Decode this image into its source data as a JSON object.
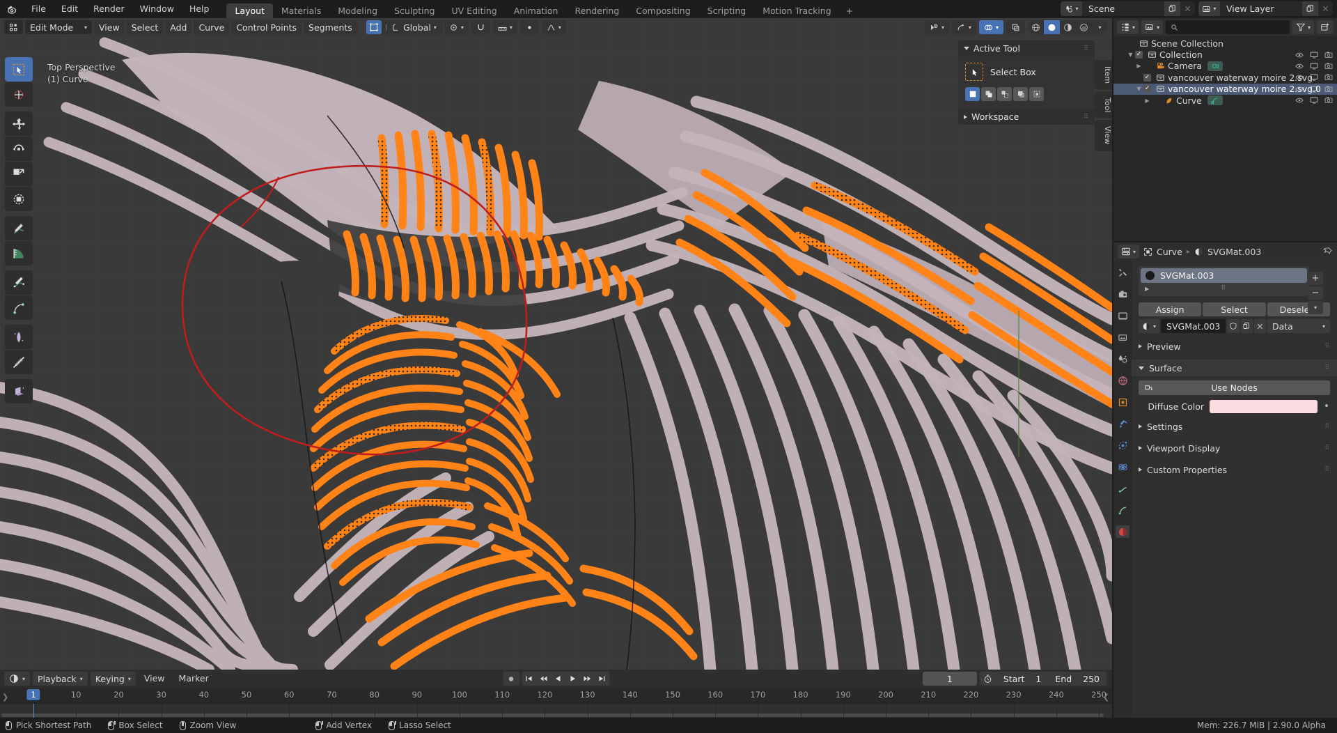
{
  "app": {
    "version_status": "Mem: 226.7 MiB | 2.90.0 Alpha"
  },
  "topbar": {
    "logo": "blender-logo",
    "menus": [
      "File",
      "Edit",
      "Render",
      "Window",
      "Help"
    ],
    "workspace_tabs": [
      {
        "label": "Layout",
        "active": true
      },
      {
        "label": "Materials",
        "active": false
      },
      {
        "label": "Modeling",
        "active": false
      },
      {
        "label": "Sculpting",
        "active": false
      },
      {
        "label": "UV Editing",
        "active": false
      },
      {
        "label": "Animation",
        "active": false
      },
      {
        "label": "Rendering",
        "active": false
      },
      {
        "label": "Compositing",
        "active": false
      },
      {
        "label": "Scripting",
        "active": false
      },
      {
        "label": "Motion Tracking",
        "active": false
      }
    ],
    "add_workspace": "+",
    "scene": {
      "icon": "scene-icon",
      "name": "Scene",
      "new_icon": "duplicate-icon",
      "unlink_icon": "x-icon"
    },
    "view_layer": {
      "icon": "viewlayer-icon",
      "name": "View Layer",
      "new_icon": "duplicate-icon",
      "unlink_icon": "x-icon"
    }
  },
  "viewport": {
    "header": {
      "mode": "Edit Mode",
      "menus": [
        "View",
        "Select",
        "Add",
        "Curve",
        "Control Points",
        "Segments"
      ],
      "transform_orientation": "Global",
      "pivot_icon": "pivot-icon",
      "snap_icon": "magnet-icon",
      "snap_to_icon": "snap-increment-icon",
      "proportional_icon": "proportional-editing-icon",
      "falloff_icon": "falloff-curve-icon",
      "visibility_icon": "object-visibility-icon",
      "gizmo_icon": "gizmo-icon",
      "overlays_icon": "overlays-icon",
      "xray_icon": "xray-icon",
      "shading_modes": [
        "wireframe",
        "solid",
        "material-preview",
        "rendered"
      ],
      "shading_active": "solid"
    },
    "overlay_text_line1": "Top Perspective",
    "overlay_text_line2": "(1) Curve",
    "toolbar_tools": [
      {
        "name": "tweak-tool",
        "active": true
      },
      {
        "name": "cursor-tool",
        "active": false
      },
      {
        "name": "move-tool",
        "active": false
      },
      {
        "name": "rotate-tool",
        "active": false
      },
      {
        "name": "scale-tool",
        "active": false
      },
      {
        "name": "transform-tool",
        "active": false
      },
      {
        "name": "annotate-tool",
        "active": false
      },
      {
        "name": "measure-tool",
        "active": false
      },
      {
        "name": "draw-curve-tool",
        "active": false
      },
      {
        "name": "extrude-curve-tool",
        "active": false
      },
      {
        "name": "radius-tool",
        "active": false
      },
      {
        "name": "tilt-tool",
        "active": false
      },
      {
        "name": "shear-tool",
        "active": false
      }
    ],
    "npanel": {
      "active_tool_label": "Active Tool",
      "tool_name": "Select Box",
      "tool_icon": "select-box-icon",
      "select_modes": [
        {
          "name": "set-mode",
          "active": true
        },
        {
          "name": "extend-mode",
          "active": false
        },
        {
          "name": "subtract-mode",
          "active": false
        },
        {
          "name": "invert-mode",
          "active": false
        },
        {
          "name": "intersect-mode",
          "active": false
        }
      ],
      "workspace_label": "Workspace",
      "vertical_tabs": [
        "Item",
        "Tool",
        "View"
      ]
    },
    "colors": {
      "background": "#3a3a3a",
      "curve_fill": "#c4b4bb",
      "selected_orange": "#ff8317",
      "control_point_dark": "#1b1b1b",
      "active_curve_red": "#c01d1d",
      "grid": "#464646"
    }
  },
  "outliner": {
    "display_mode_icon": "outliner-view-layer-icon",
    "filter_scene_icon": "viewlayer-icon",
    "search_placeholder": "",
    "search_icon": "search-icon",
    "filter_icon": "filter-icon",
    "new_collection_icon": "new-collection-icon",
    "restrict_columns": [
      "hide-in-viewport-icon",
      "disable-in-viewports-icon",
      "disable-in-renders-icon"
    ],
    "rows": [
      {
        "label": "Scene Collection",
        "icon": "collection-icon",
        "indent": 0,
        "disclosure": "",
        "checkbox": false,
        "selected": false,
        "restrict": false,
        "chip": ""
      },
      {
        "label": "Collection",
        "icon": "collection-icon",
        "indent": 1,
        "disclosure": "open",
        "checkbox": true,
        "selected": false,
        "restrict": true,
        "chip": ""
      },
      {
        "label": "Camera",
        "icon": "camera-object-icon",
        "indent": 2,
        "disclosure": "closed",
        "checkbox": false,
        "selected": false,
        "restrict": true,
        "chip": "camera-data-icon"
      },
      {
        "label": "vancouver waterway moire 2.svg",
        "icon": "collection-icon",
        "indent": 2,
        "disclosure": "",
        "checkbox": true,
        "selected": false,
        "restrict": true,
        "chip": ""
      },
      {
        "label": "vancouver waterway moire 2.svg.0",
        "icon": "collection-icon",
        "indent": 2,
        "disclosure": "open",
        "checkbox": true,
        "selected": true,
        "restrict": true,
        "chip": ""
      },
      {
        "label": "Curve",
        "icon": "curve-object-icon",
        "indent": 3,
        "disclosure": "closed",
        "checkbox": false,
        "selected": false,
        "restrict": true,
        "chip": "curve-data-icon"
      }
    ]
  },
  "properties": {
    "editor_icon": "properties-editor-icon",
    "breadcrumb": [
      {
        "label": "Curve",
        "icon": "object-data-icon"
      },
      {
        "label": "SVGMat.003",
        "icon": "material-icon"
      }
    ],
    "pin_icon": "pin-icon",
    "tabs": [
      {
        "name": "tool-tab",
        "active": false
      },
      {
        "name": "render-tab",
        "active": false
      },
      {
        "name": "output-tab",
        "active": false
      },
      {
        "name": "view-layer-tab",
        "active": false
      },
      {
        "name": "scene-tab",
        "active": false
      },
      {
        "name": "world-tab",
        "active": false
      },
      {
        "name": "object-tab",
        "active": false
      },
      {
        "name": "modifier-tab",
        "active": false
      },
      {
        "name": "particles-tab",
        "active": false
      },
      {
        "name": "physics-tab",
        "active": false
      },
      {
        "name": "constraints-tab",
        "active": false
      },
      {
        "name": "data-tab",
        "active": false
      },
      {
        "name": "material-tab",
        "active": true
      }
    ],
    "material_slot": "SVGMat.003",
    "slot_add_icon": "+",
    "slot_remove_icon": "−",
    "slot_menu_icon": "chevron-down-icon",
    "buttons": {
      "assign": "Assign",
      "select": "Select",
      "deselect": "Deselect"
    },
    "material_id": {
      "browse_icon": "material-browse-icon",
      "name": "SVGMat.003",
      "fake_user_icon": "shield-icon",
      "copy_icon": "duplicate-icon",
      "unlink_icon": "x-icon",
      "link": "Data"
    },
    "panels": [
      {
        "label": "Preview",
        "open": false
      },
      {
        "label": "Surface",
        "open": true
      },
      {
        "label": "Settings",
        "open": false
      },
      {
        "label": "Viewport Display",
        "open": false
      },
      {
        "label": "Custom Properties",
        "open": false
      }
    ],
    "use_nodes_button": "Use Nodes",
    "use_nodes_icon": "nodes-icon",
    "diffuse_color_label": "Diffuse Color",
    "diffuse_color_value": "#fbdde1"
  },
  "timeline": {
    "editor_icon": "timeline-editor-icon",
    "dropdowns": [
      "Playback",
      "Keying"
    ],
    "menus": [
      "View",
      "Marker"
    ],
    "record_icon": "record-icon",
    "transport": [
      "jump-to-start-icon",
      "jump-to-keyframe-prev-icon",
      "play-reverse-icon",
      "play-icon",
      "jump-to-keyframe-next-icon",
      "jump-to-end-icon"
    ],
    "current_frame": "1",
    "auto_key_icon": "stopwatch-icon",
    "start_label": "Start",
    "start_value": "1",
    "end_label": "End",
    "end_value": "250",
    "ruler_ticks": [
      "1",
      "10",
      "20",
      "30",
      "40",
      "50",
      "60",
      "70",
      "80",
      "90",
      "100",
      "110",
      "120",
      "130",
      "140",
      "150",
      "160",
      "170",
      "180",
      "190",
      "200",
      "210",
      "220",
      "230",
      "240",
      "250"
    ],
    "playhead_frame": "1"
  },
  "statusbar": {
    "hints": [
      {
        "mouse": "left",
        "label": "Pick Shortest Path"
      },
      {
        "mouse": "left-drag",
        "label": "Box Select"
      },
      {
        "mouse": "middle",
        "label": "Zoom View"
      }
    ],
    "hints2": [
      {
        "mouse": "left-ctrl",
        "label": "Add Vertex"
      },
      {
        "mouse": "left-drag",
        "label": "Lasso Select"
      }
    ]
  }
}
